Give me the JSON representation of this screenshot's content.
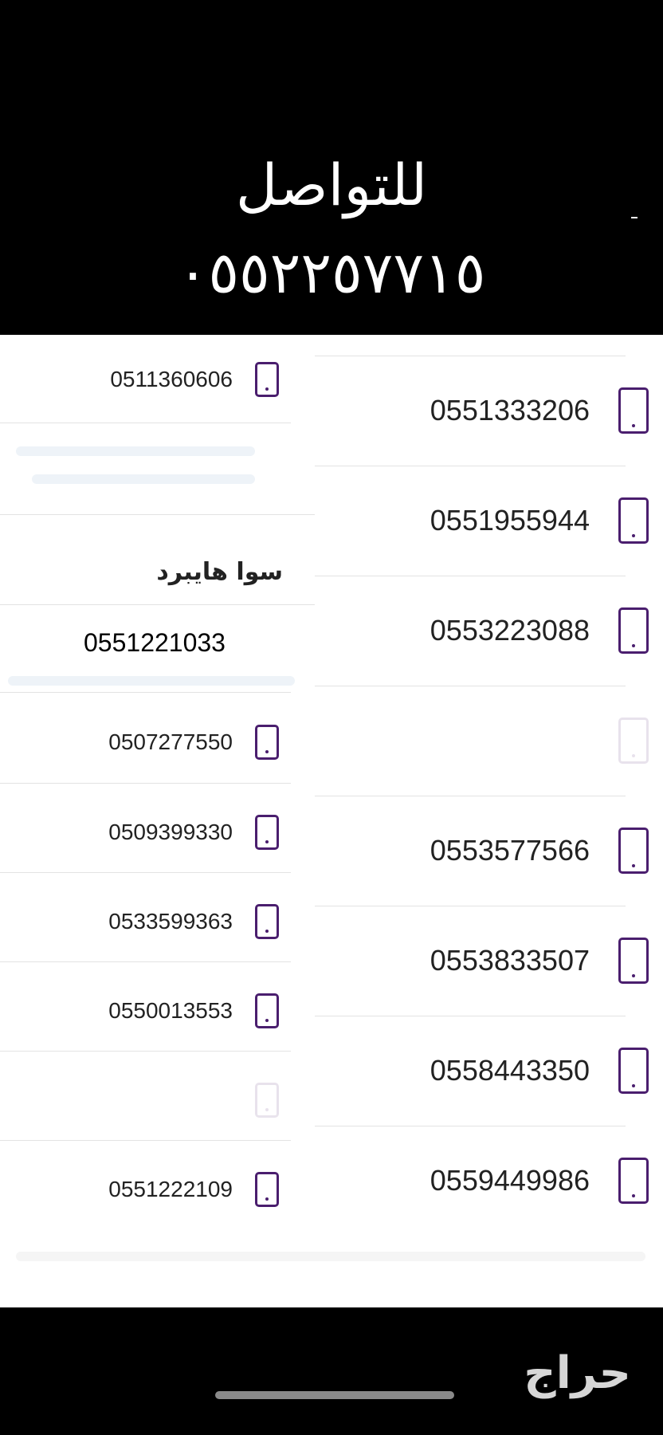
{
  "header": {
    "title": "للتواصل",
    "phone": "٠٥٥٢٢٥٧٧١٥"
  },
  "left_column": {
    "items": [
      {
        "number": "0511360606"
      },
      {
        "number": "0507277550"
      },
      {
        "number": "0509399330"
      },
      {
        "number": "0533599363"
      },
      {
        "number": "0550013553"
      },
      {
        "number": "0551222109"
      }
    ],
    "section_title": "سوا هايبرد",
    "highlight_number": "0551221033"
  },
  "right_column": {
    "items": [
      {
        "number": "0551333206"
      },
      {
        "number": "0551955944"
      },
      {
        "number": "0553223088"
      },
      {
        "number": "0553577566"
      },
      {
        "number": "0553833507"
      },
      {
        "number": "0558443350"
      },
      {
        "number": "0559449986"
      }
    ]
  },
  "footer": {
    "logo": "حراج"
  },
  "colors": {
    "accent": "#4a1e6e",
    "background": "#ffffff",
    "bar": "#000000"
  },
  "icons": [
    "phone-icon"
  ]
}
